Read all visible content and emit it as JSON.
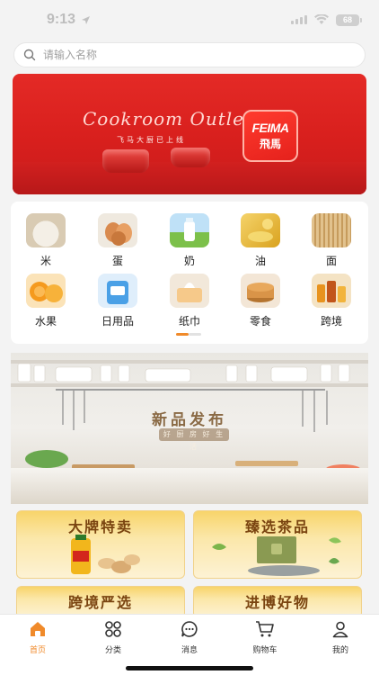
{
  "status_bar": {
    "time": "9:13",
    "battery": "68",
    "icons": [
      "signal-icon",
      "wifi-icon",
      "battery-icon"
    ]
  },
  "search": {
    "placeholder": "请输入名称",
    "icon": "search-icon"
  },
  "banner": {
    "script_text": "Cookroom Outlets",
    "subtitle": "飞马大厨已上线",
    "logo_en": "FEIMA",
    "logo_cn": "飛馬"
  },
  "categories": [
    {
      "label": "米",
      "icon": "rice-image"
    },
    {
      "label": "蛋",
      "icon": "egg-image"
    },
    {
      "label": "奶",
      "icon": "milk-image"
    },
    {
      "label": "油",
      "icon": "oil-image"
    },
    {
      "label": "面",
      "icon": "noodle-image"
    },
    {
      "label": "水果",
      "icon": "fruit-image"
    },
    {
      "label": "日用品",
      "icon": "daily-goods-image"
    },
    {
      "label": "纸巾",
      "icon": "tissue-image"
    },
    {
      "label": "零食",
      "icon": "snack-image"
    },
    {
      "label": "跨境",
      "icon": "cross-border-image"
    }
  ],
  "carousel_page": 1,
  "promo": {
    "title": "新品发布",
    "subtitle": "好 厨 房 好 生 活"
  },
  "features": [
    {
      "title": "大牌特卖"
    },
    {
      "title": "臻选茶品"
    },
    {
      "title": "跨境严选"
    },
    {
      "title": "进博好物"
    }
  ],
  "tabbar": {
    "active": "首页",
    "tabs": [
      {
        "label": "首页",
        "icon": "home-icon"
      },
      {
        "label": "分类",
        "icon": "category-icon"
      },
      {
        "label": "消息",
        "icon": "message-icon"
      },
      {
        "label": "购物车",
        "icon": "cart-icon"
      },
      {
        "label": "我的",
        "icon": "profile-icon"
      }
    ]
  },
  "colors": {
    "accent": "#f08a2a",
    "banner_red": "#e42a26",
    "feature_gold": "#f8d46a"
  }
}
